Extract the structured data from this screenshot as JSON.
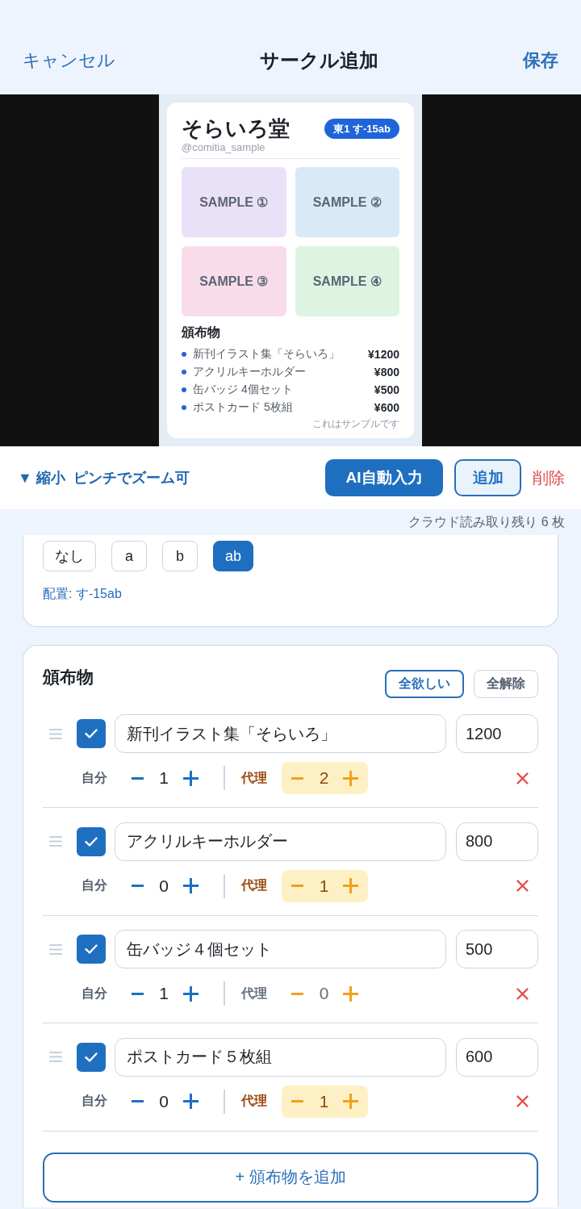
{
  "nav": {
    "cancel": "キャンセル",
    "title": "サークル追加",
    "save": "保存"
  },
  "preview": {
    "circle_name": "そらいろ堂",
    "space_badge": "東1 す-15ab",
    "handle": "@comitia_sample",
    "samples": [
      {
        "label": "SAMPLE ①",
        "color": "#e9e1f8"
      },
      {
        "label": "SAMPLE ②",
        "color": "#d8e9f8"
      },
      {
        "label": "SAMPLE ③",
        "color": "#f9dcea"
      },
      {
        "label": "SAMPLE ④",
        "color": "#ddf4e3"
      }
    ],
    "items_heading": "頒布物",
    "items": [
      {
        "name": "新刊イラスト集「そらいろ」",
        "price": "¥1200"
      },
      {
        "name": "アクリルキーホルダー",
        "price": "¥800"
      },
      {
        "name": "缶バッジ 4個セット",
        "price": "¥500"
      },
      {
        "name": "ポストカード 5枚組",
        "price": "¥600"
      }
    ],
    "note": "これはサンプルです"
  },
  "image_toolbar": {
    "collapse": "▼ 縮小",
    "hint": "ピンチでズーム可",
    "buttons": [
      {
        "label": "AI自動入力",
        "kind": "primary"
      },
      {
        "label": "追加",
        "kind": "secondary"
      },
      {
        "label": "削除",
        "kind": "danger"
      }
    ]
  },
  "cloud_remaining": "クラウド読み取り残り 6 枚",
  "space_suffix": {
    "options": [
      {
        "label": "なし",
        "selected": false
      },
      {
        "label": "a",
        "selected": false
      },
      {
        "label": "b",
        "selected": false
      },
      {
        "label": "ab",
        "selected": true
      }
    ],
    "placement": "配置: す-15ab"
  },
  "items_section": {
    "title": "頒布物",
    "actions": [
      {
        "label": "全欲しい",
        "kind": "primary"
      },
      {
        "label": "全解除",
        "kind": "secondary"
      }
    ],
    "items": [
      {
        "checked": true,
        "name": "新刊イラスト集「そらいろ」",
        "price": "1200",
        "self_label": "自分",
        "self_count": "1",
        "agent_label": "代理",
        "agent_count": "2",
        "agent_active": true
      },
      {
        "checked": true,
        "name": "アクリルキーホルダー",
        "price": "800",
        "self_label": "自分",
        "self_count": "0",
        "agent_label": "代理",
        "agent_count": "1",
        "agent_active": true
      },
      {
        "checked": true,
        "name": "缶バッジ４個セット",
        "price": "500",
        "self_label": "自分",
        "self_count": "1",
        "agent_label": "代理",
        "agent_count": "0",
        "agent_active": false
      },
      {
        "checked": true,
        "name": "ポストカード５枚組",
        "price": "600",
        "self_label": "自分",
        "self_count": "0",
        "agent_label": "代理",
        "agent_count": "1",
        "agent_active": true
      }
    ],
    "add_button": "+ 頒布物を追加"
  }
}
